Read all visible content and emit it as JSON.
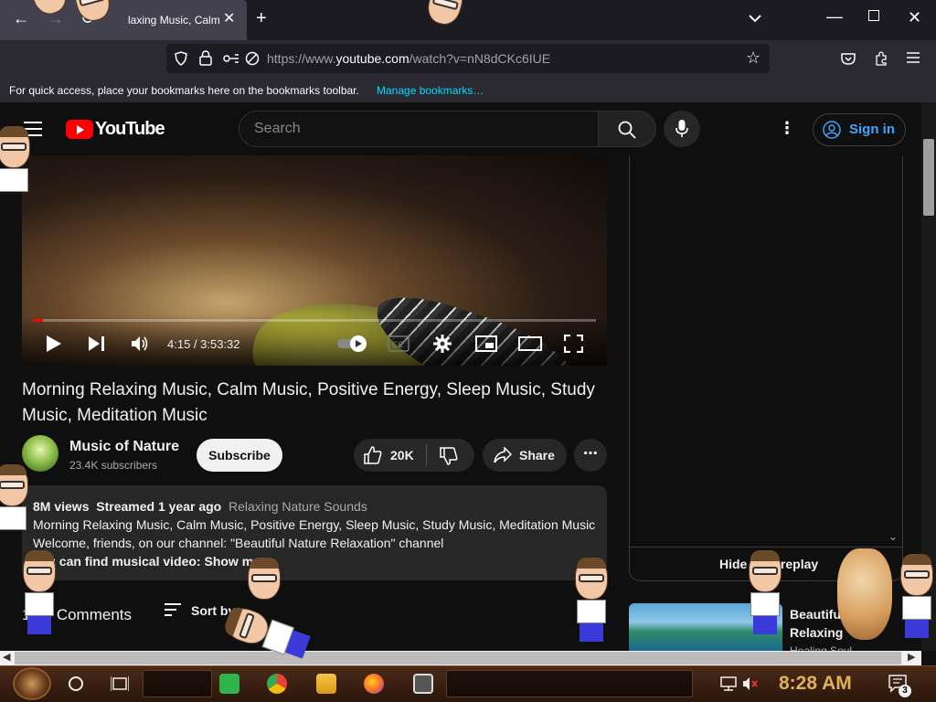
{
  "browser": {
    "tab_title": "laxing Music, Calm",
    "new_tab_symbol": "+",
    "url_prefix": "https://www.",
    "url_host": "youtube.com",
    "url_path": "/watch?v=nN8dCKc6IUE",
    "bookmarks_hint": "For quick access, place your bookmarks here on the bookmarks toolbar.",
    "bookmarks_link": "Manage bookmarks…"
  },
  "youtube": {
    "logo_text": "YouTube",
    "search_placeholder": "Search",
    "sign_in": "Sign in"
  },
  "player": {
    "time": "4:15 / 3:53:32",
    "progress_fraction": 0.018
  },
  "video": {
    "title": "Morning Relaxing Music, Calm Music, Positive Energy, Sleep Music, Study Music, Meditation Music",
    "channel_name": "Music of Nature",
    "subscribers": "23.4K subscribers",
    "subscribe_label": "Subscribe",
    "likes": "20K",
    "share_label": "Share",
    "more_symbol": "⋯"
  },
  "description": {
    "views": "8M views",
    "streamed": "Streamed 1 year ago",
    "tag": "Relaxing Nature Sounds",
    "line1": "Morning Relaxing Music, Calm Music, Positive Energy, Sleep Music, Study Music, Meditation Music",
    "line2": "Welcome, friends, on our channel: \"Beautiful Nature Relaxation\" channel",
    "line3": "you can find musical video:",
    "show_more": "Show more"
  },
  "comments": {
    "label": "Comments",
    "count_partial": "1",
    "sort_label": "Sort by"
  },
  "sidebar": {
    "hide_replay": "Hide chat replay",
    "rec_title": "Beautiful Relaxing",
    "rec_sub": "Healing Soul..."
  },
  "taskbar": {
    "clock": "8:28 AM",
    "notification_count": "3"
  },
  "colors": {
    "yt_red": "#ff0000",
    "link_blue": "#3ea6ff",
    "firefox_cyan": "#00ddff",
    "clock_amber": "#e0b05a"
  }
}
